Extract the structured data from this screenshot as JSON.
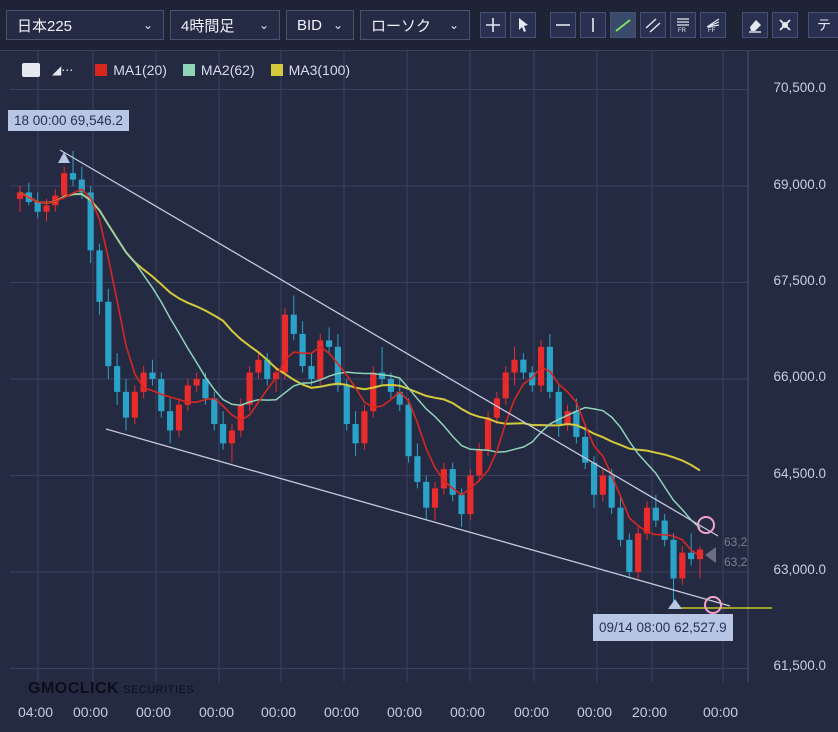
{
  "toolbar": {
    "symbol": "日本225",
    "timeframe": "4時間足",
    "price_type": "BID",
    "chart_style": "ローソク",
    "tail_label": "テ",
    "ma_labels": [
      "MA1(20)",
      "MA2(62)",
      "MA3(100)"
    ]
  },
  "colors": {
    "bull": "#ea2b2b",
    "bear": "#2ba3c9",
    "ma1": "#d7271f",
    "ma2": "#8fd3b8",
    "ma3": "#d4c93a",
    "trendline": "#c4c8dc",
    "grid": "#3a4064"
  },
  "annotations": {
    "high_label": "18 00:00 69,546.2",
    "low_label": "09/14 08:00 62,527.9",
    "price_tag_1": "63,2",
    "price_tag_2": "63,2"
  },
  "watermark": {
    "brand": "GMOCLICK",
    "suffix": "SECURITIES"
  },
  "chart_data": {
    "type": "candlestick",
    "y_axis_labels": [
      "70,500.0",
      "69,000.0",
      "67,500.0",
      "66,000.0",
      "64,500.0",
      "63,000.0",
      "61,500.0"
    ],
    "y_ticks": [
      70500,
      69000,
      67500,
      66000,
      64500,
      63000,
      61500
    ],
    "ylim": [
      61000,
      70800
    ],
    "x_axis_labels": [
      "04:00",
      "00:00",
      "00:00",
      "00:00",
      "00:00",
      "00:00",
      "00:00",
      "00:00",
      "00:00",
      "00:00",
      "20:00",
      "00:00"
    ],
    "ohlc": [
      [
        68800,
        69000,
        68600,
        68900
      ],
      [
        68900,
        69050,
        68700,
        68750
      ],
      [
        68750,
        68900,
        68500,
        68600
      ],
      [
        68600,
        68800,
        68450,
        68700
      ],
      [
        68700,
        68950,
        68600,
        68850
      ],
      [
        68850,
        69300,
        68800,
        69200
      ],
      [
        69200,
        69546,
        69000,
        69100
      ],
      [
        69100,
        69300,
        68800,
        68900
      ],
      [
        68900,
        69000,
        67800,
        68000
      ],
      [
        68000,
        68100,
        67000,
        67200
      ],
      [
        67200,
        67400,
        66000,
        66200
      ],
      [
        66200,
        66400,
        65600,
        65800
      ],
      [
        65800,
        66000,
        65200,
        65400
      ],
      [
        65400,
        65900,
        65300,
        65800
      ],
      [
        65800,
        66200,
        65700,
        66100
      ],
      [
        66100,
        66300,
        65900,
        66000
      ],
      [
        66000,
        66100,
        65400,
        65500
      ],
      [
        65500,
        65700,
        65000,
        65200
      ],
      [
        65200,
        65700,
        65100,
        65600
      ],
      [
        65600,
        66000,
        65500,
        65900
      ],
      [
        65900,
        66100,
        65800,
        66000
      ],
      [
        66000,
        66100,
        65600,
        65700
      ],
      [
        65700,
        65800,
        65200,
        65300
      ],
      [
        65300,
        65500,
        64900,
        65000
      ],
      [
        65000,
        65300,
        64700,
        65200
      ],
      [
        65200,
        65700,
        65100,
        65600
      ],
      [
        65600,
        66200,
        65500,
        66100
      ],
      [
        66100,
        66400,
        66000,
        66300
      ],
      [
        66300,
        66400,
        65900,
        66000
      ],
      [
        66000,
        66200,
        65800,
        66100
      ],
      [
        66100,
        67100,
        66000,
        67000
      ],
      [
        67000,
        67300,
        66600,
        66700
      ],
      [
        66700,
        66900,
        66100,
        66200
      ],
      [
        66200,
        66400,
        65900,
        66000
      ],
      [
        66000,
        66700,
        65900,
        66600
      ],
      [
        66600,
        66800,
        66400,
        66500
      ],
      [
        66500,
        66700,
        65800,
        65900
      ],
      [
        65900,
        66000,
        65200,
        65300
      ],
      [
        65300,
        65500,
        64800,
        65000
      ],
      [
        65000,
        65600,
        64900,
        65500
      ],
      [
        65500,
        66200,
        65400,
        66100
      ],
      [
        66100,
        66500,
        65900,
        66000
      ],
      [
        66000,
        66100,
        65700,
        65800
      ],
      [
        65800,
        66000,
        65500,
        65600
      ],
      [
        65600,
        65700,
        64700,
        64800
      ],
      [
        64800,
        65000,
        64300,
        64400
      ],
      [
        64400,
        64500,
        63800,
        64000
      ],
      [
        64000,
        64400,
        63800,
        64300
      ],
      [
        64300,
        64700,
        64200,
        64600
      ],
      [
        64600,
        64700,
        64100,
        64200
      ],
      [
        64200,
        64300,
        63700,
        63900
      ],
      [
        63900,
        64600,
        63800,
        64500
      ],
      [
        64500,
        65000,
        64400,
        64900
      ],
      [
        64900,
        65500,
        64800,
        65400
      ],
      [
        65400,
        65800,
        65300,
        65700
      ],
      [
        65700,
        66200,
        65600,
        66100
      ],
      [
        66100,
        66500,
        65900,
        66300
      ],
      [
        66300,
        66400,
        66000,
        66100
      ],
      [
        66100,
        66200,
        65800,
        65900
      ],
      [
        65900,
        66600,
        65800,
        66500
      ],
      [
        66500,
        66700,
        65700,
        65800
      ],
      [
        65800,
        65900,
        65100,
        65300
      ],
      [
        65300,
        65600,
        65200,
        65500
      ],
      [
        65500,
        65700,
        65000,
        65100
      ],
      [
        65100,
        65300,
        64600,
        64700
      ],
      [
        64700,
        64800,
        64000,
        64200
      ],
      [
        64200,
        64600,
        64100,
        64500
      ],
      [
        64500,
        64600,
        63900,
        64000
      ],
      [
        64000,
        64200,
        63400,
        63500
      ],
      [
        63500,
        63600,
        62900,
        63000
      ],
      [
        63000,
        63700,
        62900,
        63600
      ],
      [
        63600,
        64100,
        63500,
        64000
      ],
      [
        64000,
        64200,
        63700,
        63800
      ],
      [
        63800,
        63900,
        63400,
        63500
      ],
      [
        63500,
        63600,
        62527,
        62900
      ],
      [
        62900,
        63400,
        62800,
        63300
      ],
      [
        63300,
        63600,
        63100,
        63200
      ],
      [
        63200,
        63400,
        62900,
        63350
      ]
    ]
  }
}
